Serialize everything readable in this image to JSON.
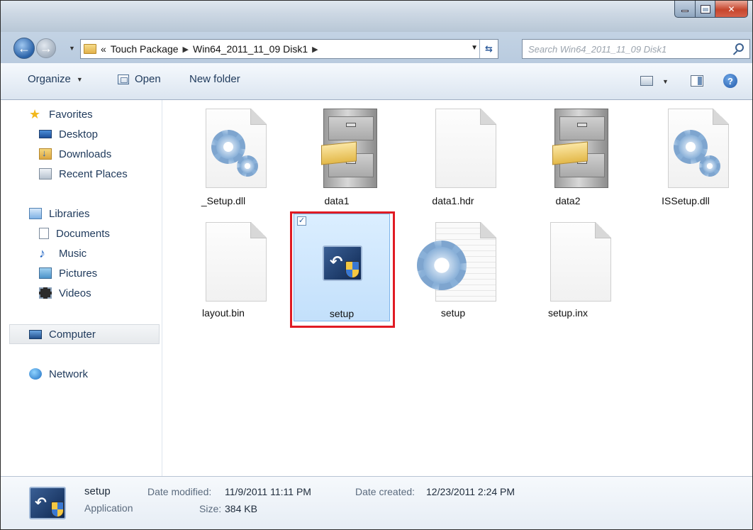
{
  "address": {
    "crumb_overflow": "«",
    "crumbs": [
      "Touch Package",
      "Win64_2011_11_09 Disk1"
    ]
  },
  "search": {
    "placeholder": "Search Win64_2011_11_09 Disk1"
  },
  "toolbar": {
    "organize": "Organize",
    "open": "Open",
    "new_folder": "New folder"
  },
  "navpane": {
    "favorites": "Favorites",
    "favorites_items": [
      "Desktop",
      "Downloads",
      "Recent Places"
    ],
    "libraries": "Libraries",
    "libraries_items": [
      "Documents",
      "Music",
      "Pictures",
      "Videos"
    ],
    "computer": "Computer",
    "network": "Network"
  },
  "files": [
    {
      "name": "_Setup.dll",
      "icon": "settings-file-icon"
    },
    {
      "name": "data1",
      "icon": "file-cabinet-icon"
    },
    {
      "name": "data1.hdr",
      "icon": "blank-file-icon"
    },
    {
      "name": "data2",
      "icon": "file-cabinet-icon"
    },
    {
      "name": "ISSetup.dll",
      "icon": "settings-file-icon"
    },
    {
      "name": "layout.bin",
      "icon": "blank-file-icon"
    },
    {
      "name": "setup",
      "icon": "installer-icon",
      "selected": true
    },
    {
      "name": "setup",
      "icon": "config-file-icon"
    },
    {
      "name": "setup.inx",
      "icon": "blank-file-icon"
    }
  ],
  "details": {
    "name": "setup",
    "type": "Application",
    "date_modified_label": "Date modified:",
    "date_modified": "11/9/2011 11:11 PM",
    "size_label": "Size:",
    "size": "384 KB",
    "date_created_label": "Date created:",
    "date_created": "12/23/2011 2:24 PM"
  },
  "colors": {
    "highlight_border": "#e01b24",
    "selection_fill": "#cfe6fc"
  }
}
